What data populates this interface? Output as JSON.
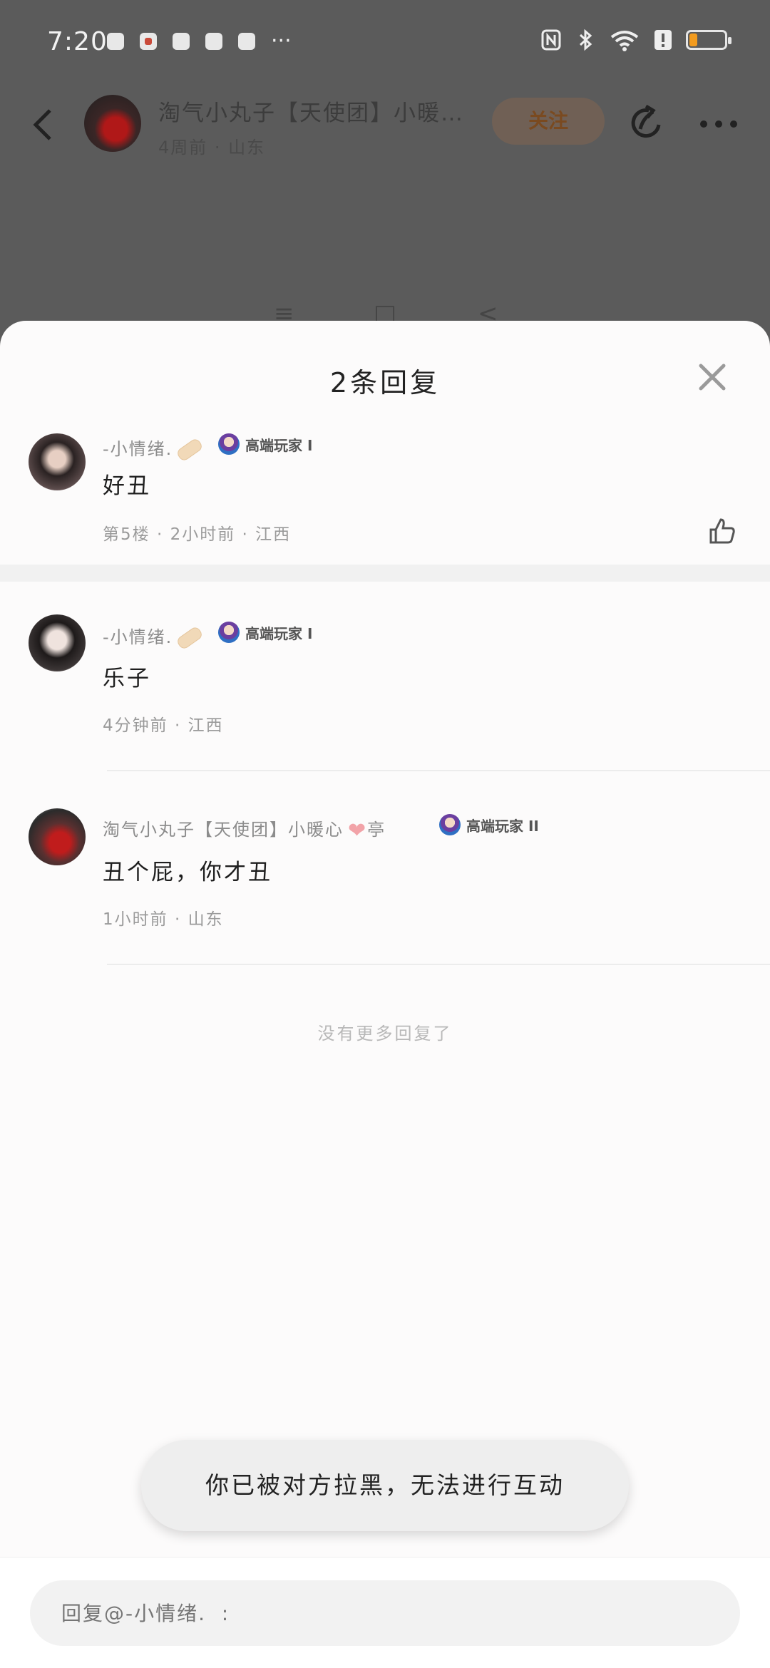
{
  "status_bar": {
    "time": "7:20",
    "more": "···",
    "battery_percent": 15
  },
  "post_header": {
    "name": "淘气小丸子【天使团】小暖…",
    "meta": "4周前 · 山东",
    "follow_label": "关注"
  },
  "nav_hint": [
    "≡",
    "□",
    "<"
  ],
  "sheet": {
    "title": "2条回复",
    "main_comment": {
      "name": "-小情绪.",
      "badge": "高端玩家 I",
      "text": "好丑",
      "meta": "第5楼 · 2小时前 · 江西"
    },
    "replies": [
      {
        "name": "-小情绪.",
        "badge": "高端玩家 I",
        "text": "乐子",
        "meta": "4分钟前 · 江西"
      },
      {
        "name": "淘气小丸子【天使团】小暖心",
        "name_suffix": "亭",
        "badge": "高端玩家 II",
        "text": "丑个屁，你才丑",
        "meta": "1小时前 · 山东"
      }
    ],
    "no_more": "没有更多回复了",
    "toast": "你已被对方拉黑，无法进行互动",
    "reply_placeholder": "回复@-小情绪.  :"
  },
  "colors": {
    "accent_orange": "#f29b1e",
    "overlay": "#5b5b5b",
    "sheet_bg": "#fcfbfb"
  }
}
